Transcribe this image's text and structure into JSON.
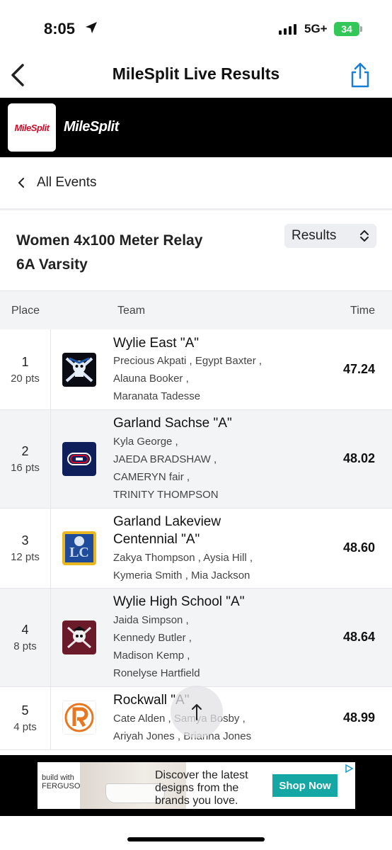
{
  "status_bar": {
    "time": "8:05",
    "network": "5G+",
    "battery": "34"
  },
  "nav": {
    "title": "MileSplit Live Results"
  },
  "brand": {
    "logo_text": "MileSplit",
    "name": "MileSplit"
  },
  "back_link": {
    "label": "All Events"
  },
  "event": {
    "title_line1": "Women 4x100 Meter Relay",
    "title_line2": "6A Varsity",
    "view_select": "Results"
  },
  "table": {
    "headers": {
      "place": "Place",
      "team": "Team",
      "time": "Time"
    },
    "rows": [
      {
        "place": "1",
        "pts": "20 pts",
        "team": "Wylie East \"A\"",
        "athletes": [
          "Precious Akpati , Egypt Baxter ,",
          "Alauna Booker ,",
          "Maranata Tadesse"
        ],
        "time": "47.24"
      },
      {
        "place": "2",
        "pts": "16 pts",
        "team": "Garland Sachse \"A\"",
        "athletes": [
          "Kyla George ,",
          "JAEDA BRADSHAW ,",
          "CAMERYN fair ,",
          "TRINITY THOMPSON"
        ],
        "time": "48.02"
      },
      {
        "place": "3",
        "pts": "12 pts",
        "team_line1": "Garland Lakeview",
        "team_line2": "Centennial \"A\"",
        "athletes": [
          "Zakya Thompson , Aysia Hill ,",
          "Kymeria Smith , Mia Jackson"
        ],
        "time": "48.60"
      },
      {
        "place": "4",
        "pts": "8 pts",
        "team": "Wylie High School \"A\"",
        "athletes": [
          "Jaida Simpson ,",
          "Kennedy Butler ,",
          "Madison Kemp ,",
          "Ronelyse Hartfield"
        ],
        "time": "48.64"
      },
      {
        "place": "5",
        "pts": "4 pts",
        "team": "Rockwall \"A\"",
        "athletes": [
          "Cate Alden , Samya Bosby ,",
          "Ariyah Jones , Brianna Jones"
        ],
        "time": "48.99"
      }
    ]
  },
  "ad": {
    "brand": "build with FERGUSON",
    "text": "Discover the latest designs from the brands you love.",
    "cta": "Shop Now"
  },
  "colors": {
    "accent": "#1a7fd4",
    "brand_red": "#c8102e",
    "ad_cta": "#14a7a3",
    "battery": "#33c759"
  }
}
